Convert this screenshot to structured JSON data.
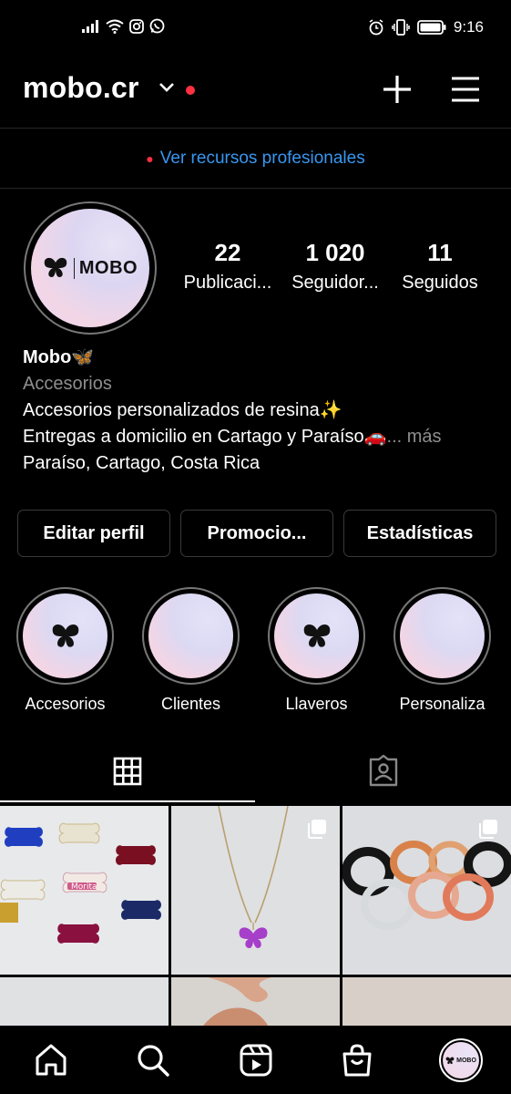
{
  "status_bar": {
    "time": "9:16"
  },
  "header": {
    "username": "mobo.cr"
  },
  "pro_banner": {
    "text": "Ver recursos profesionales"
  },
  "profile": {
    "avatar_text": "MOBO",
    "stats": [
      {
        "value": "22",
        "label": "Publicaci..."
      },
      {
        "value": "1 020",
        "label": "Seguidor..."
      },
      {
        "value": "11",
        "label": "Seguidos"
      }
    ],
    "name": "Mobo🦋",
    "category": "Accesorios",
    "bio_line1": "Accesorios personalizados de resina✨",
    "bio_line2": "Entregas a domicilio en Cartago y Paraíso🚗",
    "bio_more": "... más",
    "location": "Paraíso, Cartago, Costa Rica"
  },
  "actions": {
    "edit": "Editar perfil",
    "promote": "Promocio...",
    "insights": "Estadísticas"
  },
  "highlights": [
    {
      "label": "Accesorios"
    },
    {
      "label": "Clientes"
    },
    {
      "label": "Llaveros"
    },
    {
      "label": "Personaliza"
    }
  ],
  "grid_posts": [
    {
      "overlay_text": "Morita"
    }
  ],
  "nav_avatar_text": "MOBO"
}
